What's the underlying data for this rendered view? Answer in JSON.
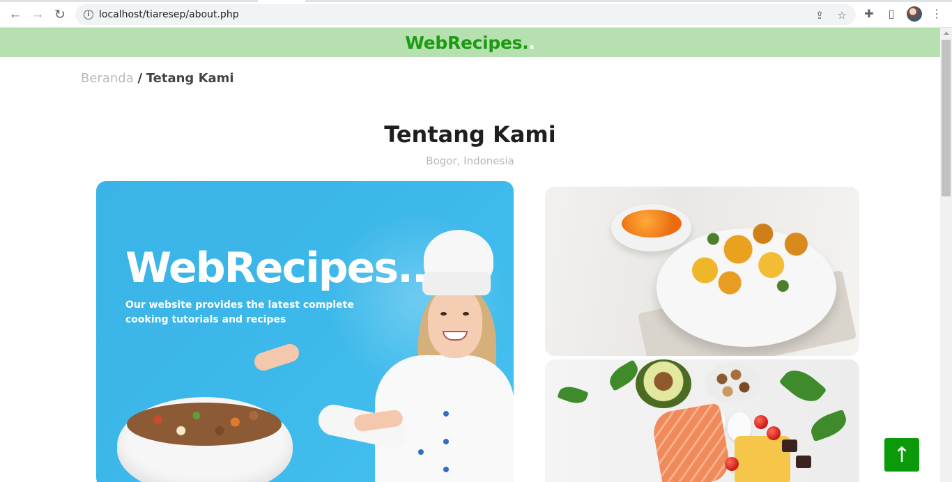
{
  "browser": {
    "url": "localhost/tiaresep/about.php",
    "back_icon": "←",
    "forward_icon": "→",
    "reload_icon": "↻",
    "info_icon": "i",
    "share_icon": "⇪",
    "star_icon": "☆",
    "extensions_icon": "✚",
    "sidebar_icon": "▯",
    "menu_icon": "⋮"
  },
  "header": {
    "brand": "WebRecipes.",
    "brand_dot": ".",
    "brand_color": "#1a9b12",
    "background": "#b7e0b1"
  },
  "breadcrumb": {
    "home": "Beranda",
    "separator": "/",
    "current": "Tetang Kami"
  },
  "about": {
    "title": "Tentang Kami",
    "location": "Bogor, Indonesia"
  },
  "hero_image": {
    "title": "WebRecipes..",
    "text": "Our website provides the latest complete cooking tutorials and recipes"
  },
  "back_to_top": {
    "icon": "↑",
    "color": "#0a9a0a"
  }
}
